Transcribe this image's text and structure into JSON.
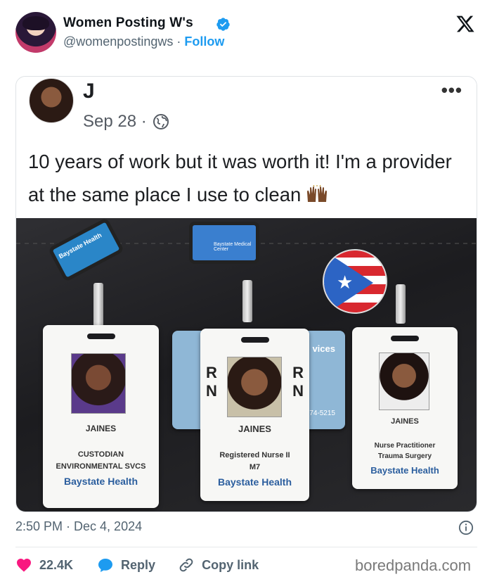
{
  "author": {
    "display_name": "Women Posting W's",
    "handle": "@womenpostingws",
    "separator": "·",
    "follow_label": "Follow",
    "verified": true
  },
  "platform_icon": "x-logo-icon",
  "embedded_post": {
    "name": "J",
    "date": "Sep 28 ·",
    "privacy_icon": "globe-icon",
    "text": "10 years of work but it was worth it! I'm a provider at the same place I use to clean",
    "emoji": "raised-hands-icon",
    "more_icon": "more-dots-icon",
    "more_label": "•••",
    "photo": {
      "badges": [
        {
          "name": "JAINES",
          "role_line1": "CUSTODIAN",
          "role_line2": "ENVIRONMENTAL SVCS",
          "brand": "Baystate Health"
        },
        {
          "name": "JAINES",
          "role_line1": "Registered Nurse II",
          "role_line2": "M7",
          "brand": "Baystate Health",
          "tag_left_top": "R",
          "tag_left_bottom": "N",
          "tag_right_top": "R",
          "tag_right_bottom": "N"
        },
        {
          "name": "JAINES",
          "role_line1": "Nurse Practitioner",
          "role_line2": "Trauma Surgery",
          "brand": "Baystate Health"
        }
      ],
      "reel_labels": [
        "Baystate Health",
        "Baystate Medical Center"
      ],
      "card_label": "vices",
      "card_phone": "74-5215"
    }
  },
  "timestamp": "2:50 PM · Dec 4, 2024",
  "actions": {
    "like_count": "22.4K",
    "reply_label": "Reply",
    "copy_label": "Copy link"
  },
  "watermark": "boredpanda.com",
  "colors": {
    "accent": "#1d9bf0",
    "like": "#f91880",
    "text": "#0f1419",
    "muted": "#536471"
  }
}
